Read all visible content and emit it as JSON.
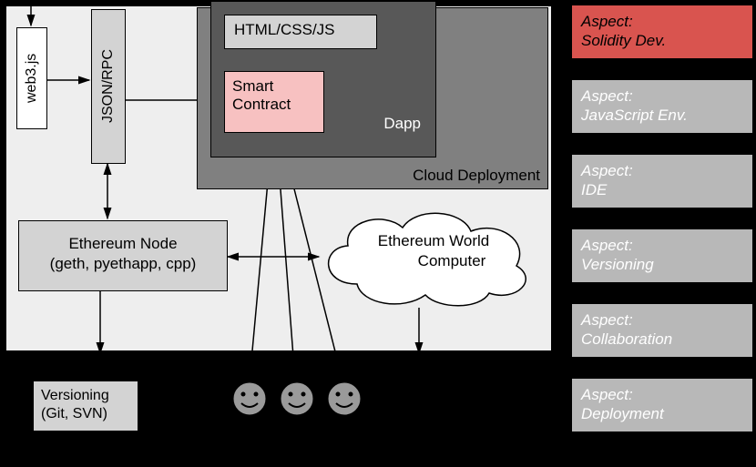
{
  "diagram": {
    "web3": "web3.js",
    "jsonrpc": "JSON/RPC",
    "cloud_deployment": "Cloud Deployment",
    "dapp": "Dapp",
    "htmlcssjs": "HTML/CSS/JS",
    "smart_contract": "Smart\nContract",
    "eth_node_line1": "Ethereum Node",
    "eth_node_line2": "(geth, pyethapp, cpp)",
    "eth_world_line1": "Ethereum World",
    "eth_world_line2": "Computer",
    "versioning": "Versioning\n(Git, SVN)"
  },
  "aspects": [
    {
      "label1": "Aspect:",
      "label2": "Solidity Dev.",
      "active": true
    },
    {
      "label1": "Aspect:",
      "label2": "JavaScript Env.",
      "active": false
    },
    {
      "label1": "Aspect:",
      "label2": "IDE",
      "active": false
    },
    {
      "label1": "Aspect:",
      "label2": "Versioning",
      "active": false
    },
    {
      "label1": "Aspect:",
      "label2": "Collaboration",
      "active": false
    },
    {
      "label1": "Aspect:",
      "label2": "Deployment",
      "active": false
    }
  ]
}
